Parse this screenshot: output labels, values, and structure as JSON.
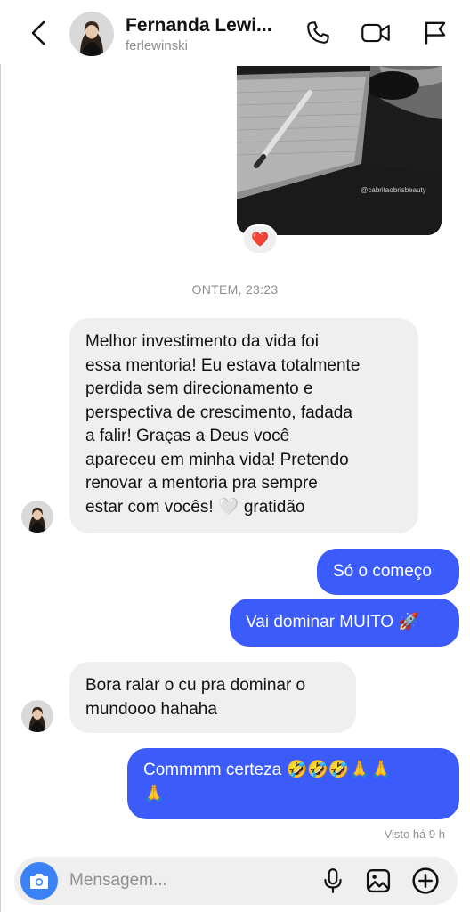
{
  "header": {
    "name": "Fernanda Lewi...",
    "username": "ferlewinski",
    "icons": [
      "back-arrow-icon",
      "phone-icon",
      "video-camera-icon",
      "flag-icon"
    ]
  },
  "shared_image": {
    "watermark": "@cabritaobrisbeauty",
    "reaction": "❤️"
  },
  "timestamp": "ONTEM, 23:23",
  "messages": [
    {
      "direction": "incoming",
      "lines": [
        "Melhor investimento da vida foi",
        "essa mentoria! Eu estava totalmente",
        "perdida sem direcionamento e",
        "perspectiva de crescimento, fadada",
        "a falir! Graças a Deus você",
        "apareceu em minha vida! Pretendo",
        "renovar a mentoria pra sempre",
        "estar com vocês! 🤍 gratidão"
      ]
    },
    {
      "direction": "outgoing",
      "text": "Só o começo"
    },
    {
      "direction": "outgoing",
      "text": "Vai dominar MUITO 🚀"
    },
    {
      "direction": "incoming",
      "lines": [
        "Bora ralar o cu pra dominar o",
        "mundooo hahaha"
      ]
    },
    {
      "direction": "outgoing",
      "lines": [
        "Commmm certeza 🤣🤣🤣🙏🙏",
        "🙏"
      ]
    }
  ],
  "seen_status": "Visto há 9 h",
  "composer": {
    "placeholder": "Mensagem...",
    "icons": [
      "camera-icon",
      "microphone-icon",
      "gallery-icon",
      "add-icon"
    ]
  },
  "colors": {
    "outgoing_bubble": "#3b5bfa",
    "incoming_bubble": "#efefef",
    "camera_button": "#3b82f6",
    "muted_text": "#8e8e8e"
  }
}
